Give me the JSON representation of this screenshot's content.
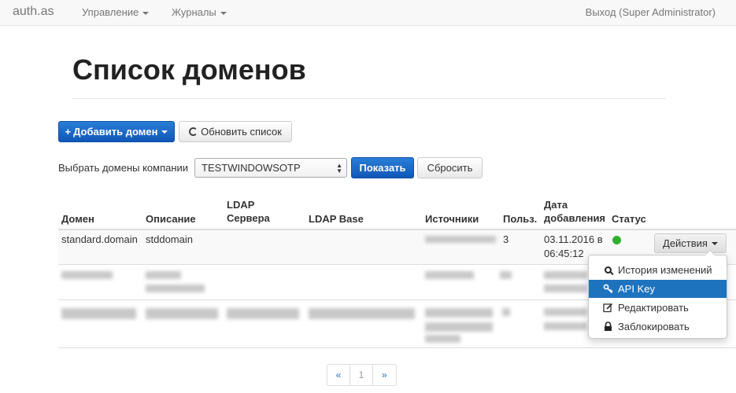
{
  "navbar": {
    "brand": "auth.as",
    "menu_management": "Управление",
    "menu_logs": "Журналы",
    "logout": "Выход (Super Administrator)"
  },
  "page": {
    "title": "Список доменов"
  },
  "toolbar": {
    "add_domain": "Добавить домен",
    "refresh": "Обновить список"
  },
  "filter": {
    "label": "Выбрать домены компании",
    "selected_company": "TESTWINDOWSOTP",
    "show_button": "Показать",
    "reset_button": "Сбросить"
  },
  "table": {
    "headers": {
      "domain": "Домен",
      "description": "Описание",
      "ldap_line1": "LDAP",
      "ldap_line2": "Сервера",
      "ldap_base": "LDAP Base",
      "sources": "Источники",
      "users": "Польз.",
      "date_line1": "Дата",
      "date_line2": "добавления",
      "status": "Статус"
    },
    "rows": [
      {
        "domain": "standard.domain",
        "description": "stddomain",
        "users": "3",
        "date_line1": "03.11.2016 в",
        "date_line2": "06:45:12",
        "actions": "Действия"
      }
    ]
  },
  "actions_menu": {
    "items": [
      {
        "label": "История изменений",
        "icon": "search-icon"
      },
      {
        "label": "API Key",
        "icon": "key-icon"
      },
      {
        "label": "Редактировать",
        "icon": "edit-icon"
      },
      {
        "label": "Заблокировать",
        "icon": "lock-icon"
      }
    ],
    "active_index": 1
  },
  "pagination": {
    "prev": "«",
    "current": "1",
    "next": "»"
  },
  "colors": {
    "primary": "#1e73be",
    "status_active": "#2fb12f"
  }
}
